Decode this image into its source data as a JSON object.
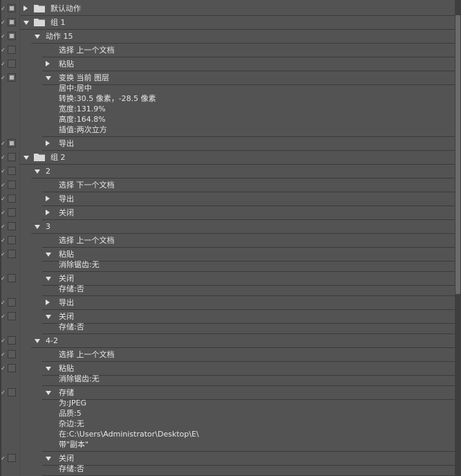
{
  "rows": [
    {
      "depth": 0,
      "label": "默认动作",
      "expanded": false,
      "dialog": true,
      "folder": true
    },
    {
      "depth": 0,
      "label": "组 1",
      "expanded": true,
      "dialog": true,
      "folder": true
    },
    {
      "depth": 1,
      "label": "动作 15",
      "expanded": true,
      "dialog": true,
      "folder": false
    },
    {
      "depth": 2,
      "label": "选择 上一个文档",
      "expanded": null,
      "dialog": false,
      "folder": false
    },
    {
      "depth": 2,
      "label": "粘贴",
      "expanded": false,
      "dialog": false,
      "folder": false
    },
    {
      "depth": 2,
      "label": "变换 当前 图层",
      "expanded": true,
      "dialog": true,
      "folder": false,
      "params": [
        "居中:居中",
        "转换:30.5 像素，-28.5 像素",
        "宽度:131.9%",
        "高度:164.8%",
        "插值:两次立方"
      ]
    },
    {
      "depth": 2,
      "label": "导出",
      "expanded": false,
      "dialog": true,
      "folder": false
    },
    {
      "depth": 0,
      "label": "组 2",
      "expanded": true,
      "dialog": false,
      "folder": true
    },
    {
      "depth": 1,
      "label": "2",
      "expanded": true,
      "dialog": false,
      "folder": false
    },
    {
      "depth": 2,
      "label": "选择 下一个文档",
      "expanded": null,
      "dialog": false,
      "folder": false
    },
    {
      "depth": 2,
      "label": "导出",
      "expanded": false,
      "dialog": false,
      "folder": false
    },
    {
      "depth": 2,
      "label": "关闭",
      "expanded": false,
      "dialog": false,
      "folder": false
    },
    {
      "depth": 1,
      "label": "3",
      "expanded": true,
      "dialog": false,
      "folder": false
    },
    {
      "depth": 2,
      "label": "选择 上一个文档",
      "expanded": null,
      "dialog": false,
      "folder": false
    },
    {
      "depth": 2,
      "label": "粘贴",
      "expanded": true,
      "dialog": false,
      "folder": false,
      "params": [
        "消除锯齿:无"
      ]
    },
    {
      "depth": 2,
      "label": "关闭",
      "expanded": true,
      "dialog": false,
      "folder": false,
      "params": [
        "存储:否"
      ]
    },
    {
      "depth": 2,
      "label": "导出",
      "expanded": false,
      "dialog": false,
      "folder": false
    },
    {
      "depth": 2,
      "label": "关闭",
      "expanded": true,
      "dialog": false,
      "folder": false,
      "params": [
        "存储:否"
      ]
    },
    {
      "depth": 1,
      "label": "4-2",
      "expanded": true,
      "dialog": false,
      "folder": false
    },
    {
      "depth": 2,
      "label": "选择 上一个文档",
      "expanded": null,
      "dialog": false,
      "folder": false
    },
    {
      "depth": 2,
      "label": "粘贴",
      "expanded": true,
      "dialog": false,
      "folder": false,
      "params": [
        "消除锯齿:无"
      ]
    },
    {
      "depth": 2,
      "label": "存储",
      "expanded": true,
      "dialog": false,
      "folder": false,
      "params": [
        "为:JPEG",
        "品质:5",
        "杂边:无",
        "在:C:\\Users\\Administrator\\Desktop\\E\\",
        "带\"副本\""
      ]
    },
    {
      "depth": 2,
      "label": "关闭",
      "expanded": true,
      "dialog": false,
      "folder": false,
      "params": [
        "存储:否"
      ]
    }
  ]
}
